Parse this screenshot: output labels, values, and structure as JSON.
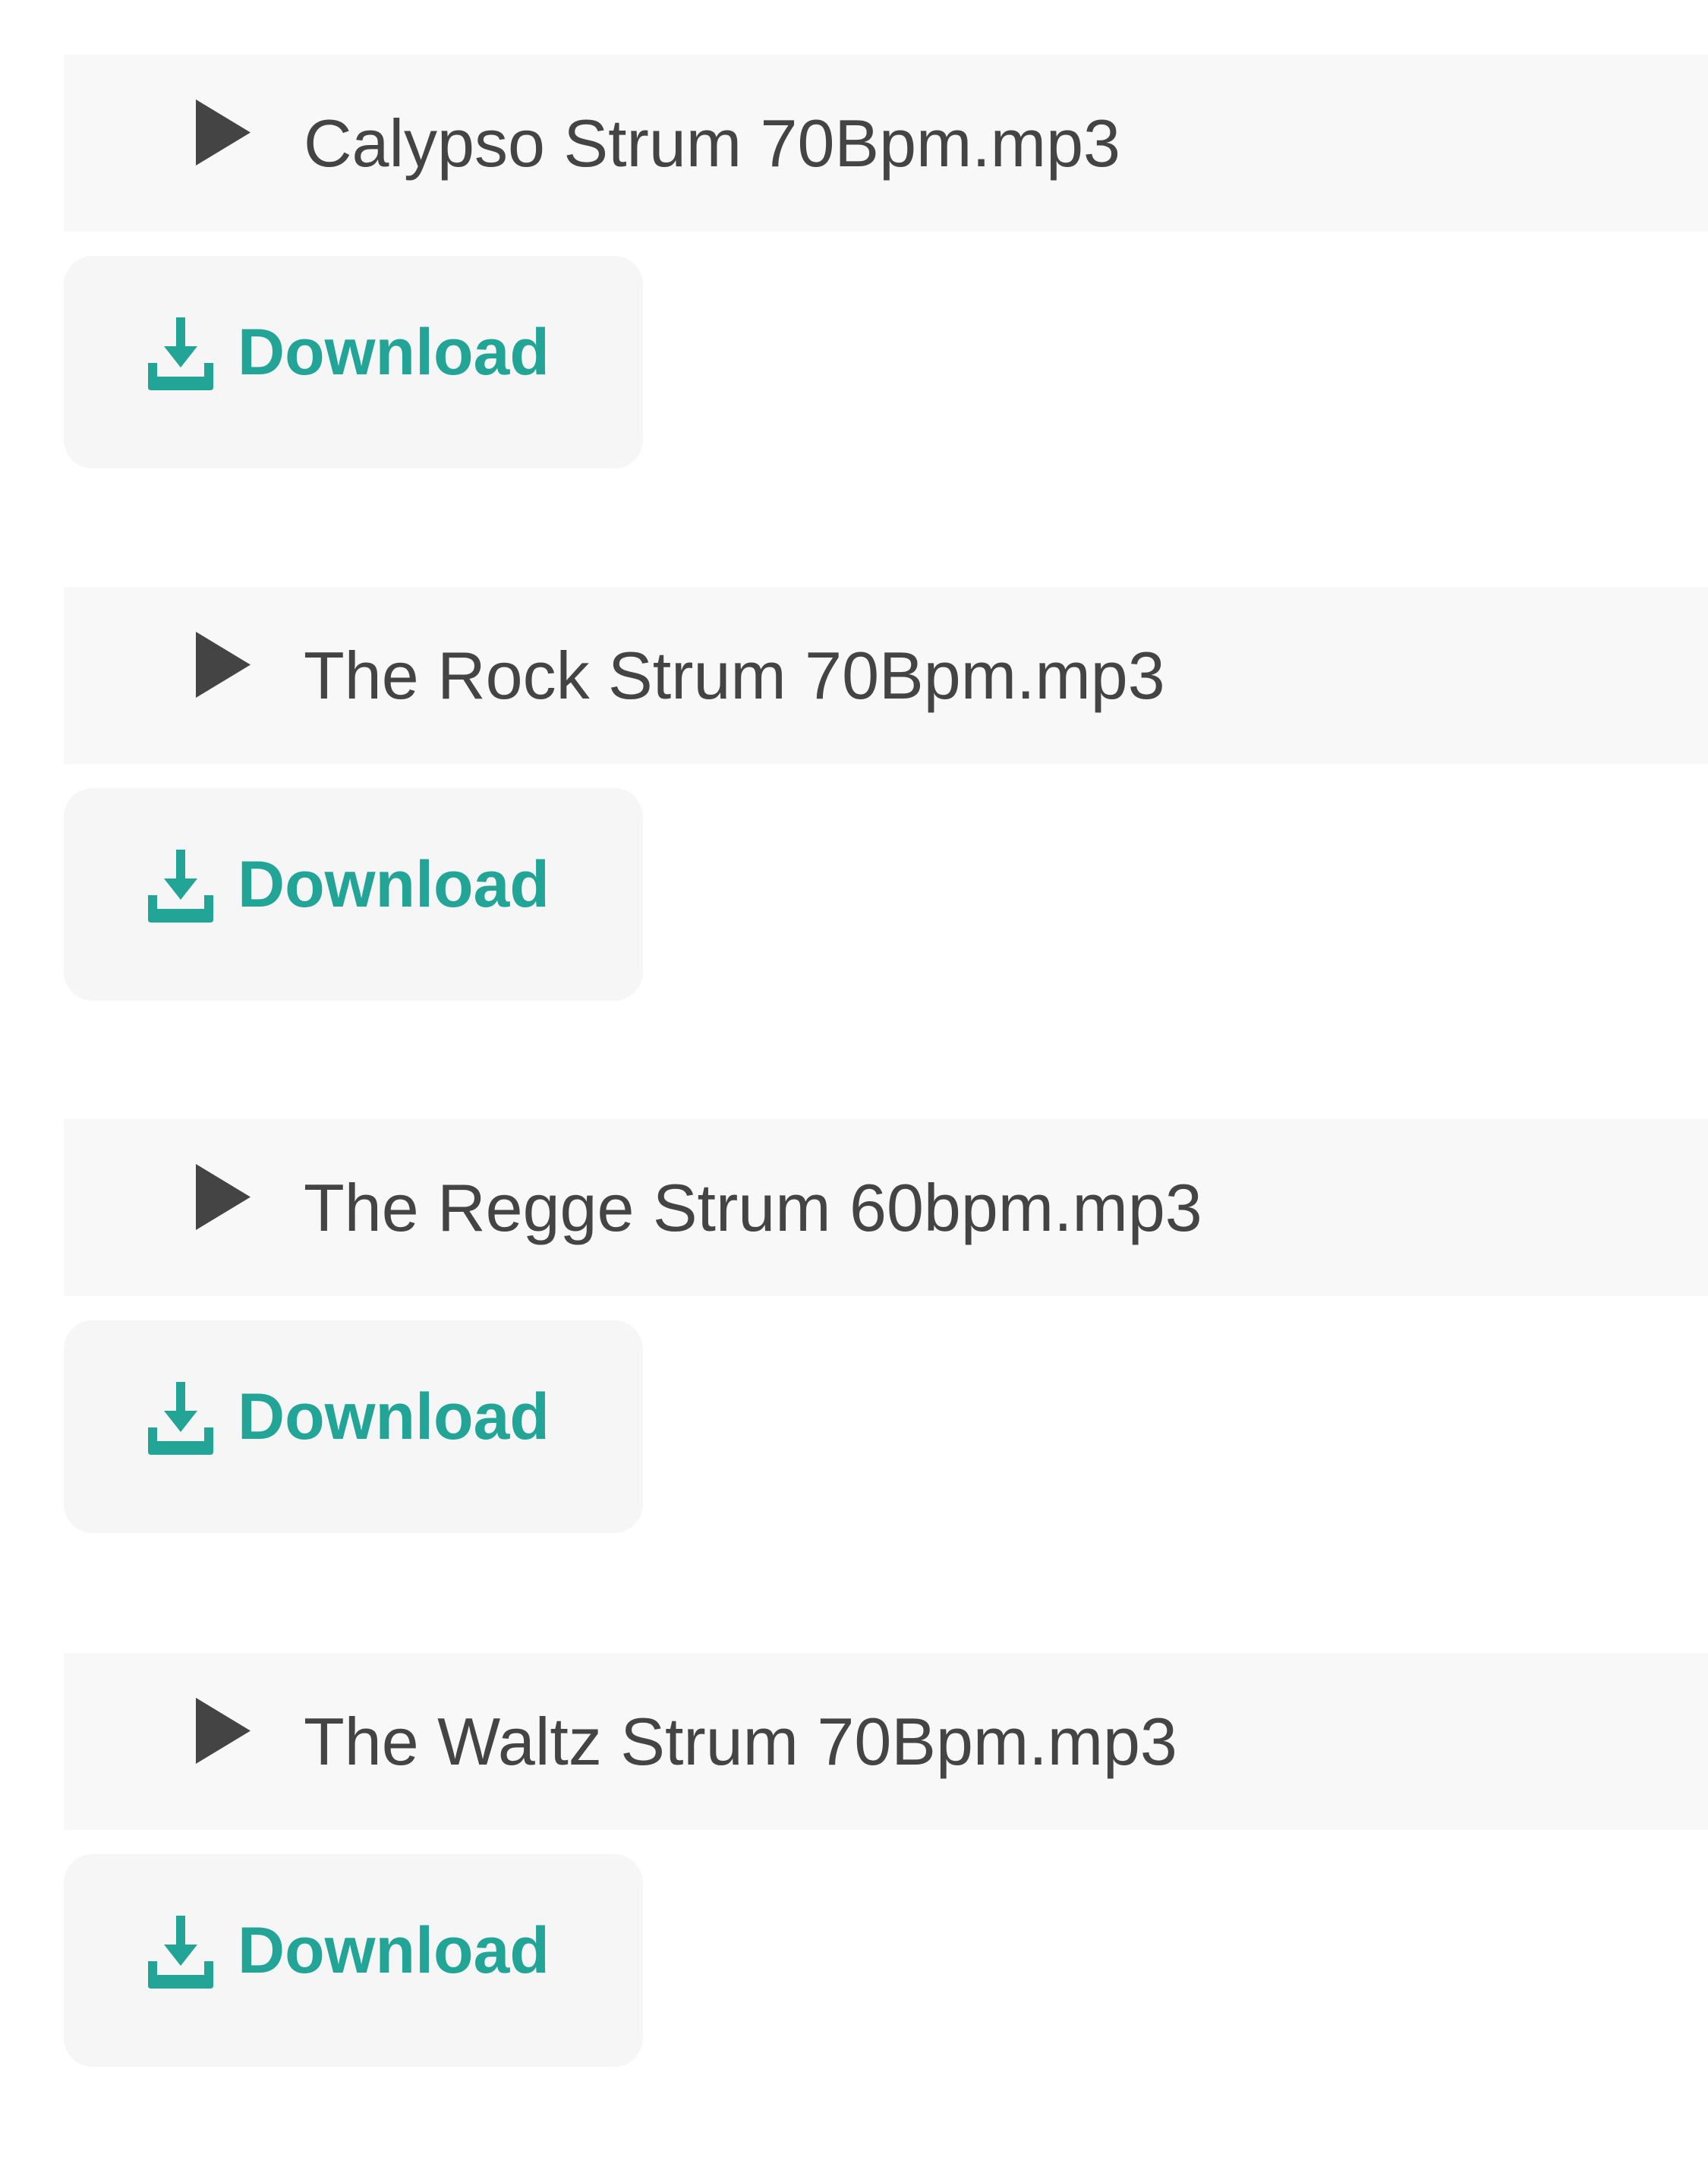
{
  "colors": {
    "player_background": "#f8f8f8",
    "download_background": "#f6f6f6",
    "accent": "#22a497",
    "text": "#444444"
  },
  "icons": {
    "play": "play-icon",
    "download": "download-icon"
  },
  "tracks": [
    {
      "name": "Calypso Strum 70Bpm.mp3",
      "download_label": "Download"
    },
    {
      "name": "The Rock Strum 70Bpm.mp3",
      "download_label": "Download"
    },
    {
      "name": "The Regge Strum 60bpm.mp3",
      "download_label": "Download"
    },
    {
      "name": "The Waltz Strum 70Bpm.mp3",
      "download_label": "Download"
    }
  ]
}
